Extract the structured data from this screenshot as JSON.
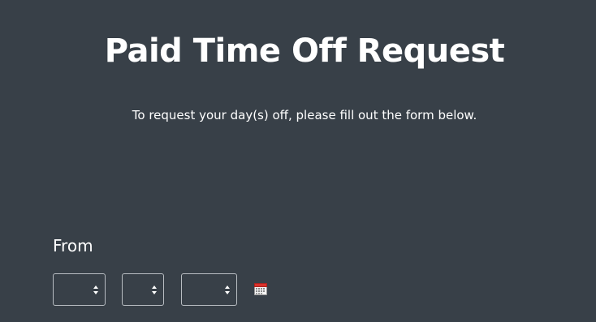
{
  "header": {
    "title": "Paid Time Off Request",
    "subtitle": "To request your day(s) off, please fill out the form below."
  },
  "from_field": {
    "label": "From",
    "selects": [
      {
        "name": "month",
        "value": ""
      },
      {
        "name": "day",
        "value": ""
      },
      {
        "name": "year",
        "value": ""
      }
    ],
    "calendar_icon": "calendar-icon"
  },
  "colors": {
    "background": "#384048",
    "text": "#ffffff",
    "select_border": "#b8bdc2"
  }
}
